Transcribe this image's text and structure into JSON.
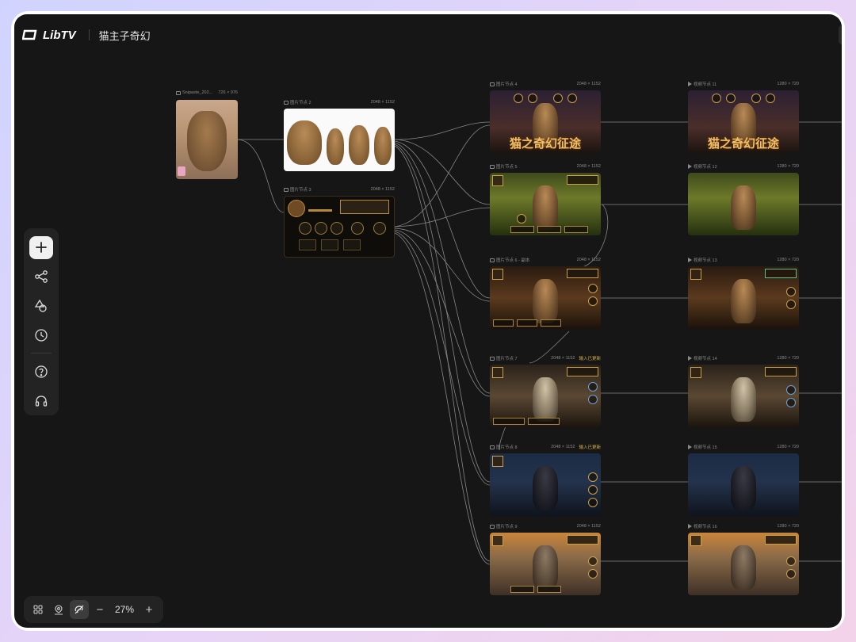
{
  "app": {
    "brand": "LibTV",
    "project_title": "猫主子奇幻"
  },
  "nodes": {
    "source": {
      "label": "Snipaste_202...",
      "size": "726 × 976"
    },
    "image2": {
      "label": "图片节点 2",
      "size": "2048 × 1152"
    },
    "image3": {
      "label": "图片节点 3",
      "size": "2048 × 1152"
    },
    "image4": {
      "label": "图片节点 4",
      "size": "2048 × 1152",
      "title_text": "猫之奇幻征途"
    },
    "image5": {
      "label": "图片节点 5",
      "size": "2048 × 1152"
    },
    "image6": {
      "label": "图片节点 6 - 副本",
      "size": "2048 × 1152"
    },
    "image7": {
      "label": "图片节点 7",
      "size": "2048 × 1152",
      "status": "输入已更新"
    },
    "image8": {
      "label": "图片节点 8",
      "size": "2048 × 1152",
      "status": "输入已更新"
    },
    "image9": {
      "label": "图片节点 9",
      "size": "2048 × 1152"
    },
    "video11": {
      "label": "视频节点 11",
      "size": "1280 × 720",
      "title_text": "猫之奇幻征途"
    },
    "video12": {
      "label": "视频节点 12",
      "size": "1280 × 720"
    },
    "video13": {
      "label": "视频节点 13",
      "size": "1280 × 720"
    },
    "video14": {
      "label": "视频节点 14",
      "size": "1280 × 720"
    },
    "video15": {
      "label": "视频节点 15",
      "size": "1280 × 720"
    },
    "video16": {
      "label": "视频节点 16",
      "size": "1280 × 720"
    }
  },
  "left_toolbar": {
    "items": [
      {
        "icon": "plus-icon"
      },
      {
        "icon": "workflow-icon"
      },
      {
        "icon": "shapes-icon"
      },
      {
        "icon": "history-clock-icon"
      },
      {
        "icon": "help-icon"
      },
      {
        "icon": "headset-icon"
      }
    ]
  },
  "bottom_toolbar": {
    "zoom": "27%",
    "zoom_out_label": "−",
    "zoom_in_label": "+"
  },
  "colors": {
    "canvas_bg": "#161616",
    "wire": "#9a9a9a",
    "accent_gold": "#c9a04e",
    "status": "#d4b04a"
  }
}
